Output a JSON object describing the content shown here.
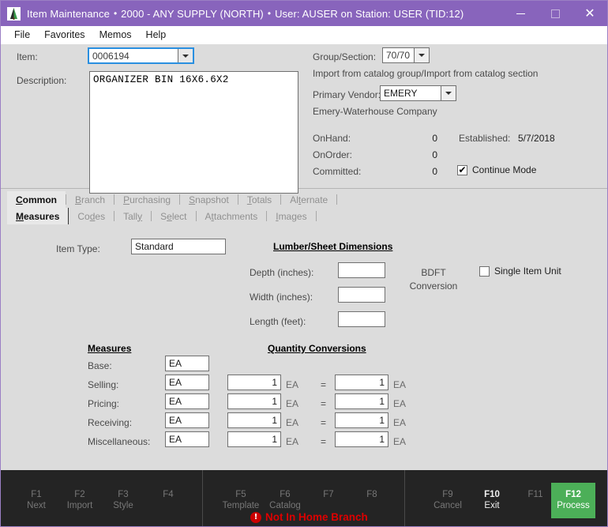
{
  "window": {
    "icon": "tree-icon",
    "title": "Item Maintenance",
    "company": "2000 - ANY SUPPLY (NORTH)",
    "session": "User: AUSER on Station: USER (TID:12)",
    "separator": "•",
    "minimize_label": "minimize",
    "maximize_label": "maximize",
    "close_label": "✕",
    "titlebar_color": "#8864bc"
  },
  "menu": {
    "items": [
      {
        "label": "File"
      },
      {
        "label": "Favorites"
      },
      {
        "label": "Memos"
      },
      {
        "label": "Help"
      }
    ]
  },
  "header": {
    "item_label": "Item:",
    "item_value": "0006194",
    "description_label": "Description:",
    "description_value": "ORGANIZER BIN 16X6.6X2",
    "group_section_label": "Group/Section:",
    "group_section_value": "70/70",
    "group_section_note": "Import from catalog group/Import from catalog section",
    "primary_vendor_label": "Primary Vendor:",
    "primary_vendor_value": "EMERY",
    "primary_vendor_note": "Emery-Waterhouse Company",
    "onhand_label": "OnHand:",
    "onhand_value": "0",
    "onorder_label": "OnOrder:",
    "onorder_value": "0",
    "committed_label": "Committed:",
    "committed_value": "0",
    "established_label": "Established:",
    "established_value": "5/7/2018",
    "continue_mode_label": "Continue Mode",
    "continue_mode_checked": "✔"
  },
  "tabs_primary": [
    {
      "label": "Common",
      "accel": "C",
      "pre": "",
      "post": "ommon",
      "active": true
    },
    {
      "label": "Branch",
      "accel": "B",
      "pre": "",
      "post": "ranch",
      "active": false
    },
    {
      "label": "Purchasing",
      "accel": "P",
      "pre": "",
      "post": "urchasing",
      "active": false
    },
    {
      "label": "Snapshot",
      "accel": "S",
      "pre": "",
      "post": "napshot",
      "active": false
    },
    {
      "label": "Totals",
      "accel": "T",
      "pre": "",
      "post": "otals",
      "active": false
    },
    {
      "label": "Alternate",
      "accel": "t",
      "pre": "Al",
      "post": "ernate",
      "active": false
    }
  ],
  "tabs_secondary": [
    {
      "label": "Measures",
      "accel": "M",
      "pre": "",
      "post": "easures",
      "active": true
    },
    {
      "label": "Codes",
      "accel": "d",
      "pre": "Co",
      "post": "es",
      "active": false
    },
    {
      "label": "Tally",
      "accel": "y",
      "pre": "Tall",
      "post": "",
      "active": false
    },
    {
      "label": "Select",
      "accel": "e",
      "pre": "S",
      "post": "lect",
      "active": false
    },
    {
      "label": "Attachments",
      "accel": "t",
      "pre": "A",
      "post": "tachments",
      "active": false
    },
    {
      "label": "Images",
      "accel": "I",
      "pre": "",
      "post": "mages",
      "active": false
    }
  ],
  "form": {
    "item_type_label": "Item Type:",
    "item_type_value": "Standard",
    "lumber_heading": "Lumber/Sheet Dimensions",
    "depth_label": "Depth (inches):",
    "depth_value": "",
    "width_label": "Width    (inches):",
    "length_label": "Length (feet):",
    "length_value": "",
    "width_value": "",
    "bdft_line1": "BDFT",
    "bdft_line2": "Conversion",
    "single_item_unit_label": "Single Item Unit",
    "measures_heading": "Measures",
    "quantity_heading": "Quantity Conversions",
    "equals": "=",
    "rows": [
      {
        "label": "Base:",
        "uom": "EA",
        "has_conv": false,
        "from_qty": "",
        "from_uom": "",
        "to_qty": "",
        "to_uom": ""
      },
      {
        "label": "Selling:",
        "uom": "EA",
        "has_conv": true,
        "from_qty": "1",
        "from_uom": "EA",
        "to_qty": "1",
        "to_uom": "EA"
      },
      {
        "label": "Pricing:",
        "uom": "EA",
        "has_conv": true,
        "from_qty": "1",
        "from_uom": "EA",
        "to_qty": "1",
        "to_uom": "EA"
      },
      {
        "label": "Receiving:",
        "uom": "EA",
        "has_conv": true,
        "from_qty": "1",
        "from_uom": "EA",
        "to_qty": "1",
        "to_uom": "EA"
      },
      {
        "label": "Miscellaneous:",
        "uom": "EA",
        "has_conv": true,
        "from_qty": "1",
        "from_uom": "EA",
        "to_qty": "1",
        "to_uom": "EA"
      }
    ]
  },
  "footer": {
    "keys": [
      {
        "key": "F1",
        "name": "Next",
        "enabled": false,
        "highlight": false
      },
      {
        "key": "F2",
        "name": "Import",
        "enabled": false,
        "highlight": false
      },
      {
        "key": "F3",
        "name": "Style",
        "enabled": false,
        "highlight": false
      },
      {
        "key": "F4",
        "name": "",
        "enabled": false,
        "highlight": false
      },
      {
        "key": "F5",
        "name": "Template",
        "enabled": false,
        "highlight": false
      },
      {
        "key": "F6",
        "name": "Catalog",
        "enabled": false,
        "highlight": false
      },
      {
        "key": "F7",
        "name": "",
        "enabled": false,
        "highlight": false
      },
      {
        "key": "F8",
        "name": "",
        "enabled": false,
        "highlight": false
      },
      {
        "key": "F9",
        "name": "Cancel",
        "enabled": false,
        "highlight": false
      },
      {
        "key": "F10",
        "name": "Exit",
        "enabled": true,
        "highlight": false
      },
      {
        "key": "F11",
        "name": "",
        "enabled": false,
        "highlight": false
      },
      {
        "key": "F12",
        "name": "Process",
        "enabled": true,
        "highlight": true
      }
    ],
    "warning_text": "Not In Home Branch",
    "warning_icon": "!",
    "warning_color": "#dd0000",
    "process_color": "#4caf58"
  }
}
